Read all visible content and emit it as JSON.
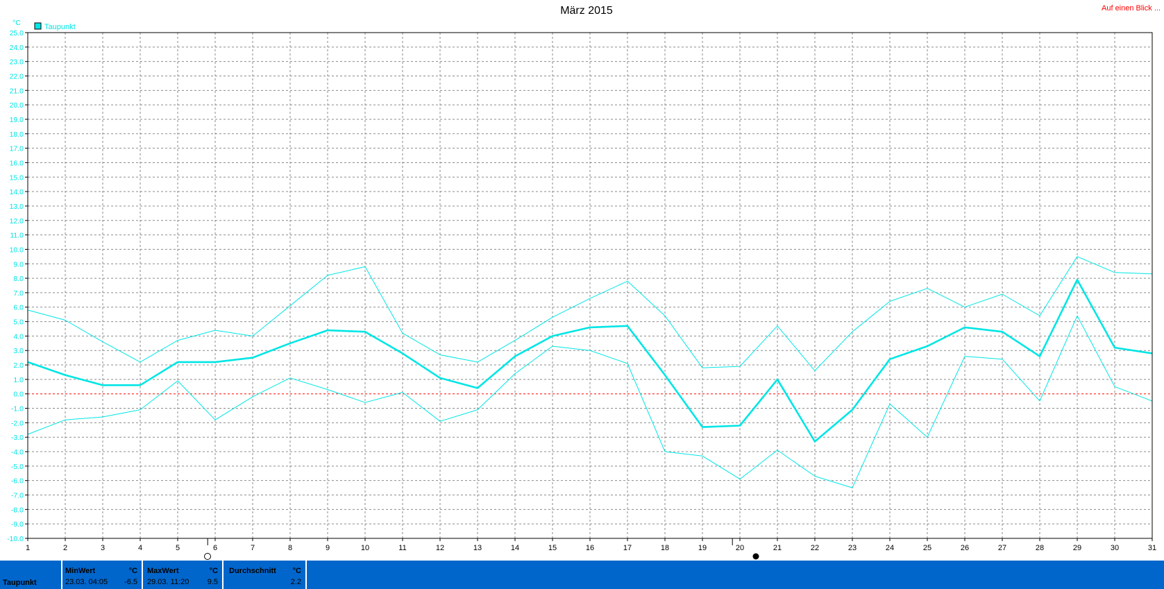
{
  "title": "März 2015",
  "top_link": "Auf einen Blick ...",
  "legend": {
    "label": "Taupunkt",
    "color": "#00e5e5"
  },
  "y_unit": "°C",
  "colors": {
    "series": "#00e5e5",
    "zero_line": "#ff0000",
    "grid": "#8a8a8a",
    "stats_bg": "#0066cc"
  },
  "icons": {
    "day6": "sun-icon",
    "day20": "moon-icon"
  },
  "chart_data": {
    "type": "line",
    "x": [
      1,
      2,
      3,
      4,
      5,
      6,
      7,
      8,
      9,
      10,
      11,
      12,
      13,
      14,
      15,
      16,
      17,
      18,
      19,
      20,
      21,
      22,
      23,
      24,
      25,
      26,
      27,
      28,
      29,
      30,
      31
    ],
    "xlim": [
      1,
      31
    ],
    "ylim": [
      -10.0,
      25.0
    ],
    "y_tick_step": 1.0,
    "grid": true,
    "legend_position": "top-left",
    "series": [
      {
        "name": "Taupunkt",
        "role": "max",
        "width": 1,
        "values": [
          5.8,
          5.1,
          3.6,
          2.2,
          3.7,
          4.4,
          4.0,
          6.1,
          8.2,
          8.8,
          4.2,
          2.7,
          2.2,
          3.7,
          5.3,
          6.6,
          7.8,
          5.4,
          1.8,
          1.9,
          4.7,
          1.6,
          4.3,
          6.4,
          7.3,
          6.0,
          6.9,
          5.4,
          9.5,
          8.4,
          8.3
        ]
      },
      {
        "name": "Taupunkt",
        "role": "avg",
        "width": 2.6,
        "values": [
          2.2,
          1.3,
          0.6,
          0.6,
          2.2,
          2.2,
          2.5,
          3.5,
          4.4,
          4.3,
          2.8,
          1.1,
          0.4,
          2.6,
          4.0,
          4.6,
          4.7,
          1.3,
          -2.3,
          -2.2,
          1.0,
          -3.3,
          -1.1,
          2.4,
          3.3,
          4.6,
          4.3,
          2.6,
          7.9,
          3.2,
          2.8
        ]
      },
      {
        "name": "Taupunkt",
        "role": "min",
        "width": 1,
        "values": [
          -2.8,
          -1.8,
          -1.6,
          -1.1,
          0.9,
          -1.8,
          -0.2,
          1.1,
          0.3,
          -0.6,
          0.1,
          -1.9,
          -1.1,
          1.4,
          3.3,
          3.0,
          2.1,
          -4.0,
          -4.3,
          -5.9,
          -3.9,
          -5.7,
          -6.5,
          -0.7,
          -3.0,
          2.6,
          2.4,
          -0.5,
          5.4,
          0.5,
          -0.5
        ]
      }
    ]
  },
  "stats": {
    "row_label": "Taupunkt",
    "min": {
      "header": "MinWert",
      "unit": "°C",
      "when": "23.03.  04:05",
      "value": "-6.5"
    },
    "max": {
      "header": "MaxWert",
      "unit": "°C",
      "when": "29.03.  11:20",
      "value": "9.5"
    },
    "avg": {
      "header": "Durchschnitt",
      "unit": "°C",
      "value": "2.2"
    }
  }
}
